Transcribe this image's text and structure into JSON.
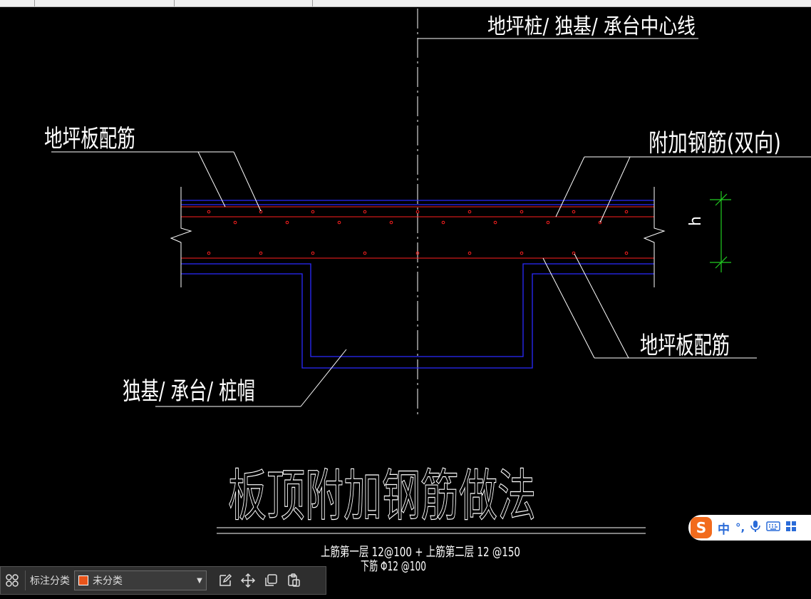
{
  "labels": {
    "centerline": "地坪桩/ 独基/ 承台中心线",
    "slab_rebar_left": "地坪板配筋",
    "additional_rebar": "附加钢筋(双向)",
    "slab_rebar_right": "地坪板配筋",
    "foundation": "独基/ 承台/ 桩帽",
    "dimension_h": "h",
    "title": "板顶附加钢筋做法",
    "spec_line1": "上筋第一层 12@100 + 上筋第二层 12 @150",
    "spec_line2": "下筋 Φ12 @100"
  },
  "toolbar": {
    "category_label": "标注分类",
    "category_value": "未分类",
    "category_color": "#e8541a",
    "icons": [
      "grid-icon",
      "edit-icon",
      "move-icon",
      "copy-icon",
      "paste-icon"
    ]
  },
  "ime": {
    "logo": "S",
    "mode": "中",
    "punct": "°,",
    "voice_icon": "microphone-icon",
    "keyboard_icon": "keyboard-icon"
  },
  "colors": {
    "background": "#000000",
    "linework": "#ffffff",
    "rebar": "#ff2020",
    "concrete_outline": "#2a2aff",
    "dimension": "#22cc22"
  }
}
